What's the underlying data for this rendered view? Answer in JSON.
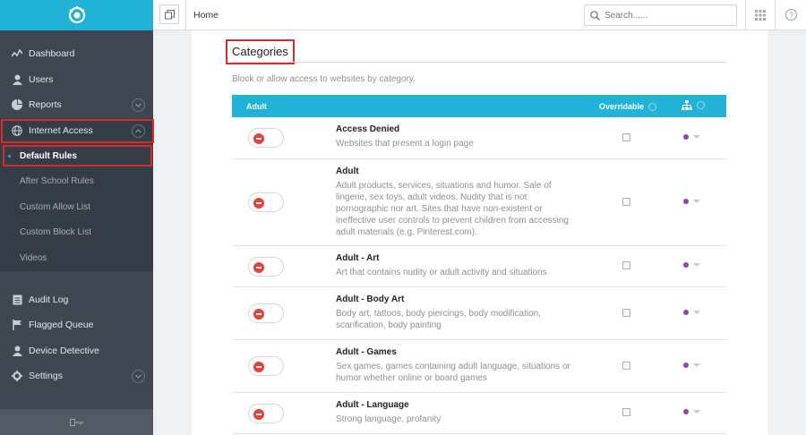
{
  "topbar": {
    "breadcrumb": "Home",
    "search_placeholder": "Search......"
  },
  "sidebar": {
    "items_top": [
      {
        "label": "Dashboard",
        "icon": "dashboard-icon"
      },
      {
        "label": "Users",
        "icon": "user-icon"
      },
      {
        "label": "Reports",
        "icon": "pie-chart-icon"
      },
      {
        "label": "Internet Access",
        "icon": "globe-icon"
      }
    ],
    "sub_items": [
      {
        "label": "Default Rules"
      },
      {
        "label": "After School Rules"
      },
      {
        "label": "Custom Allow List"
      },
      {
        "label": "Custom Block List"
      },
      {
        "label": "Videos"
      }
    ],
    "items_bottom": [
      {
        "label": "Audit Log",
        "icon": "log-icon"
      },
      {
        "label": "Flagged Queue",
        "icon": "flag-icon"
      },
      {
        "label": "Device Detective",
        "icon": "user-icon"
      },
      {
        "label": "Settings",
        "icon": "gear-icon"
      }
    ]
  },
  "main": {
    "title": "Categories",
    "description": "Block or allow access to websites by category.",
    "table": {
      "col_adult": "Adult",
      "col_overridable": "Overridable"
    },
    "rows": [
      {
        "name": "Access Denied",
        "desc": "Websites that present a login page"
      },
      {
        "name": "Adult",
        "desc": "Adult products, services, situations and humor. Sale of lingerie, sex toys, adult videos. Nudity that is not pornographic nor art. Sites that have non-existent or ineffective user controls to prevent children from accessing adult materials (e.g. Pinterest.com)."
      },
      {
        "name": "Adult - Art",
        "desc": "Art that contains nudity or adult activity and situations"
      },
      {
        "name": "Adult - Body Art",
        "desc": "Body art, tattoos, body piercings, body modification, scarification, body painting"
      },
      {
        "name": "Adult - Games",
        "desc": "Sex games, games containing adult language, situations or humor whether online or board games"
      },
      {
        "name": "Adult - Language",
        "desc": "Strong language, profanity"
      }
    ]
  },
  "colors": {
    "accent": "#21b2d8",
    "sidebar_bg": "#3d4752",
    "highlight": "#d92b2b",
    "block": "#e8413b",
    "policy_dot": "#8e44ad"
  }
}
